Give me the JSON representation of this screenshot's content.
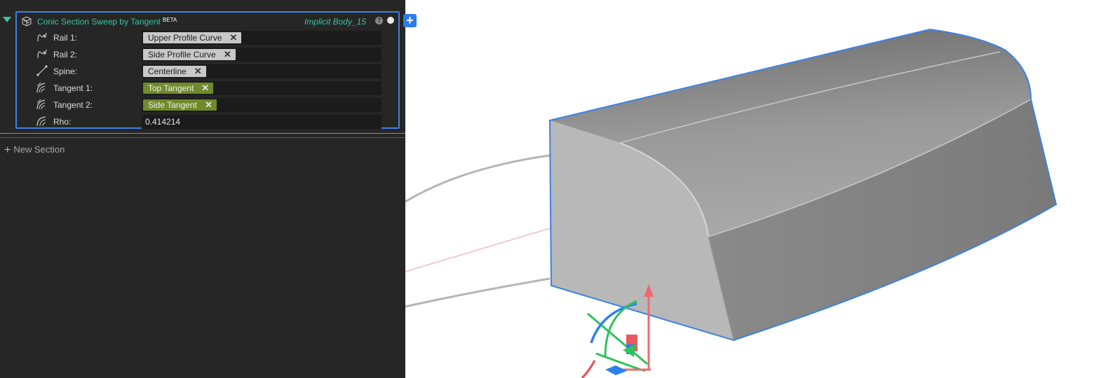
{
  "node": {
    "title": "Conic Section Sweep by Tangent",
    "badge": "BETA",
    "body_name": "Implicit Body_15",
    "help_icon": "question-circle-icon",
    "status_icon": "status-dot-icon",
    "node_icon": "conic-sweep-icon"
  },
  "add_button": "+",
  "inputs": [
    {
      "label": "Rail 1:",
      "icon": "rail-curve-icon",
      "value": "Upper Profile Curve",
      "kind": "chip-gray"
    },
    {
      "label": "Rail 2:",
      "icon": "rail-curve-icon",
      "value": "Side Profile Curve",
      "kind": "chip-gray"
    },
    {
      "label": "Spine:",
      "icon": "spine-line-icon",
      "value": "Centerline",
      "kind": "chip-gray"
    },
    {
      "label": "Tangent 1:",
      "icon": "tangent-field-icon",
      "value": "Top Tangent",
      "kind": "chip-green"
    },
    {
      "label": "Tangent 2:",
      "icon": "tangent-field-icon",
      "value": "Side Tangent",
      "kind": "chip-green"
    },
    {
      "label": "Rho:",
      "icon": "rho-arcs-icon",
      "value": "0.414214",
      "kind": "text"
    }
  ],
  "chip_remove_symbol": "✕",
  "new_section": {
    "label": "New Section",
    "icon": "plus-icon",
    "symbol": "+"
  },
  "colors": {
    "accent_teal": "#39c3a0",
    "selection_blue": "#3b82e6",
    "tangent_green": "#718a2a",
    "panel_bg": "#262626"
  },
  "viewport": {
    "object": "swept-solid-body",
    "gizmo": "transform-gizmo-icon"
  }
}
